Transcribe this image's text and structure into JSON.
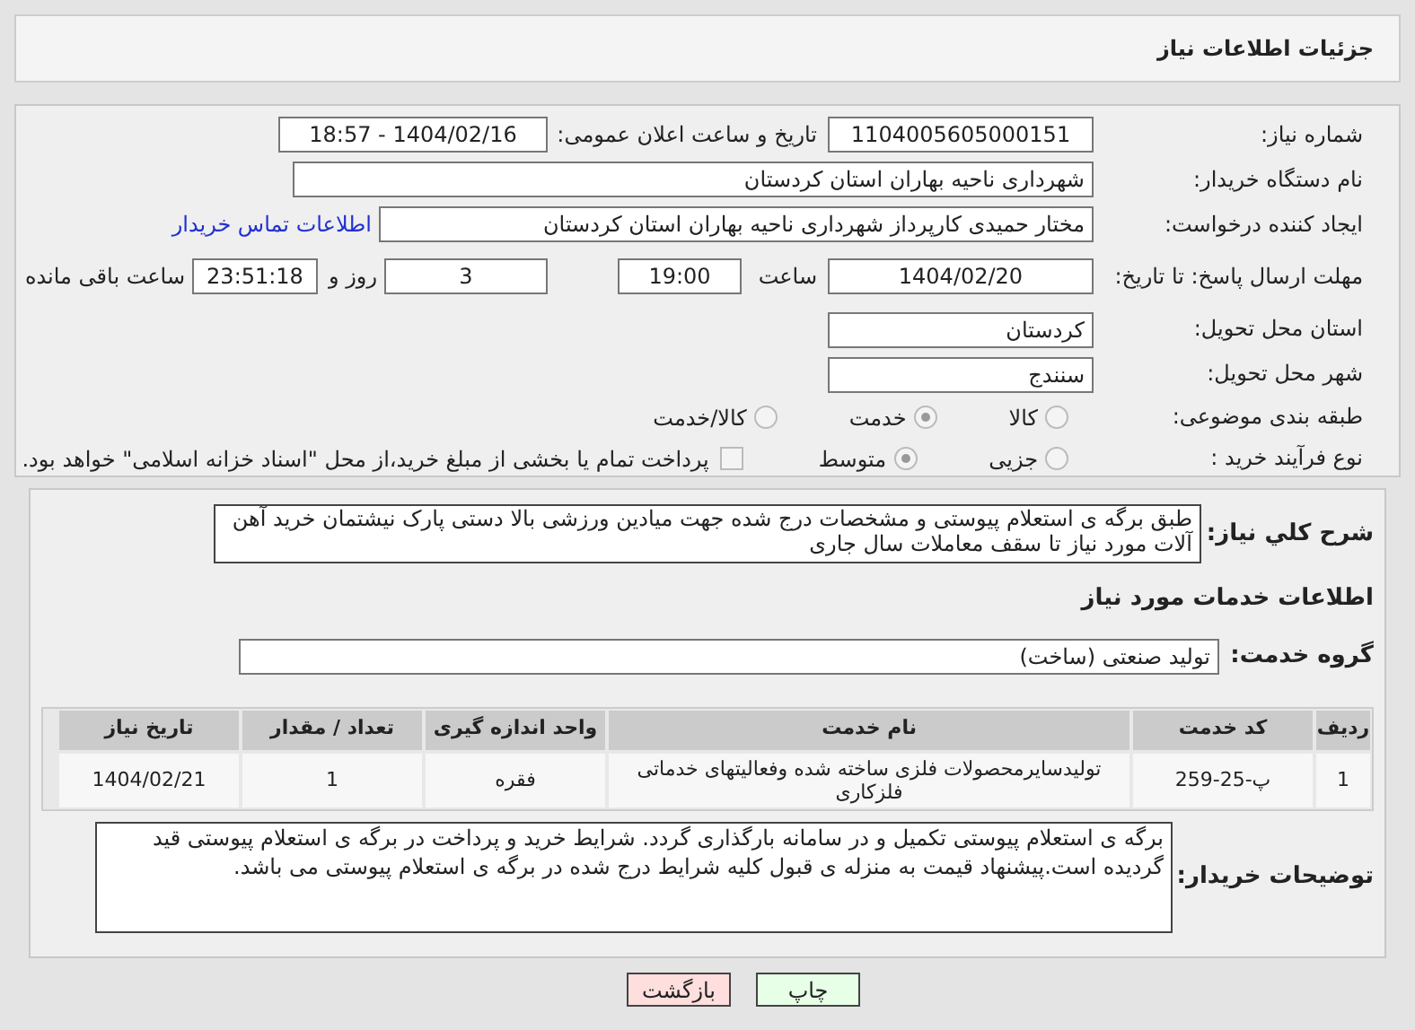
{
  "header": {
    "title": "جزئیات اطلاعات نیاز"
  },
  "need_number": {
    "label": "شماره نیاز:",
    "value": "1104005605000151"
  },
  "announce": {
    "label": "تاریخ و ساعت اعلان عمومی:",
    "value": "1404/02/16 - 18:57"
  },
  "buyer_org": {
    "label": "نام دستگاه خریدار:",
    "value": "شهرداری ناحیه بهاران استان کردستان"
  },
  "requester": {
    "label": "ایجاد کننده درخواست:",
    "value": "مختار حمیدی کارپرداز شهرداری ناحیه بهاران استان کردستان",
    "link": "اطلاعات تماس خریدار"
  },
  "deadline": {
    "label": "مهلت ارسال پاسخ: تا تاریخ:",
    "date": "1404/02/20",
    "time_label": "ساعت",
    "time": "19:00",
    "days": "3",
    "days_label": "روز و",
    "remaining": "23:51:18",
    "remaining_label": "ساعت باقی مانده"
  },
  "province": {
    "label": "استان محل تحویل:",
    "value": "کردستان"
  },
  "city": {
    "label": "شهر محل تحویل:",
    "value": "سنندج"
  },
  "category": {
    "label": "طبقه بندی موضوعی:",
    "options": [
      {
        "label": "کالا",
        "selected": false
      },
      {
        "label": "خدمت",
        "selected": true
      },
      {
        "label": "کالا/خدمت",
        "selected": false
      }
    ]
  },
  "process": {
    "label": "نوع فرآیند خرید :",
    "options": [
      {
        "label": "جزیی",
        "selected": false
      },
      {
        "label": "متوسط",
        "selected": true
      }
    ],
    "payment": {
      "label": "پرداخت تمام یا بخشی از مبلغ خرید،از محل \"اسناد خزانه اسلامی\" خواهد بود.",
      "checked": false
    }
  },
  "description": {
    "label": "شرح کلي نياز:",
    "value": "طبق برگه ی استعلام پیوستی و مشخصات درج شده جهت میادین ورزشی بالا دستی پارک نیشتمان خرید آهن آلات مورد نیاز تا سقف معاملات سال جاری"
  },
  "services_title": "اطلاعات خدمات مورد نیاز",
  "service_group": {
    "label": "گروه خدمت:",
    "value": "تولید صنعتی (ساخت)"
  },
  "table": {
    "columns": [
      "ردیف",
      "کد خدمت",
      "نام خدمت",
      "واحد اندازه گیری",
      "تعداد / مقدار",
      "تاریخ نیاز"
    ],
    "rows": [
      [
        "1",
        "پ-25-259",
        "تولیدسایرمحصولات فلزی ساخته شده وفعالیتهای خدماتی فلزکاری",
        "فقره",
        "1",
        "1404/02/21"
      ]
    ]
  },
  "buyer_notes": {
    "label": "توضیحات خریدار:",
    "value": "برگه ی استعلام پیوستی تکمیل و در سامانه بارگذاری گردد. شرایط خرید و پرداخت در برگه ی استعلام پیوستی قید گردیده است.پیشنهاد قیمت به منزله ی قبول کلیه شرایط درج شده در برگه ی استعلام پیوستی می باشد."
  },
  "buttons": [
    {
      "label": "چاپ",
      "kind": "print"
    },
    {
      "label": "بازگشت",
      "kind": "back"
    }
  ]
}
